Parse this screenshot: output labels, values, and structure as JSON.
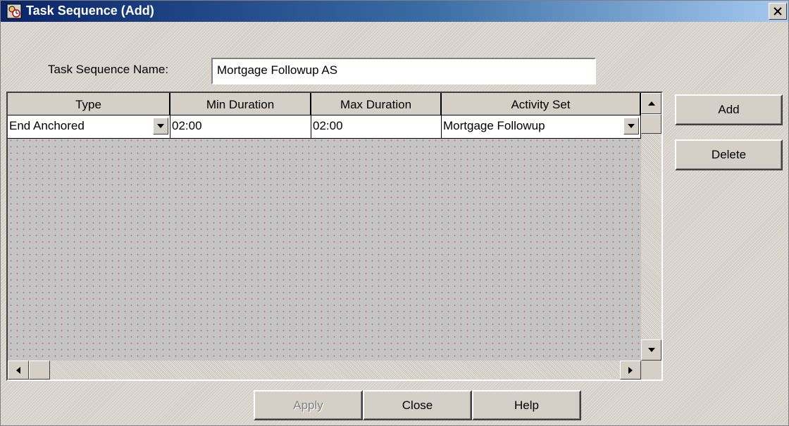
{
  "window": {
    "title": "Task Sequence (Add)"
  },
  "form": {
    "name_label": "Task Sequence Name:",
    "name_value": "Mortgage Followup AS"
  },
  "grid": {
    "columns": [
      "Type",
      "Min Duration",
      "Max Duration",
      "Activity Set"
    ],
    "rows": [
      {
        "type": "End Anchored",
        "min": "02:00",
        "max": "02:00",
        "activity_set": "Mortgage Followup"
      }
    ]
  },
  "side_buttons": {
    "add": "Add",
    "delete": "Delete"
  },
  "bottom_buttons": {
    "apply": "Apply",
    "close": "Close",
    "help": "Help"
  },
  "icons": {
    "app": "task-sequence-icon",
    "close": "close-icon",
    "dropdown": "chevron-down-icon",
    "scroll_up": "arrow-up-icon",
    "scroll_down": "arrow-down-icon",
    "scroll_left": "arrow-left-icon",
    "scroll_right": "arrow-right-icon"
  },
  "colors": {
    "titlebar_start": "#0a246a",
    "titlebar_end": "#a6caf0",
    "face": "#d4d0c8"
  }
}
